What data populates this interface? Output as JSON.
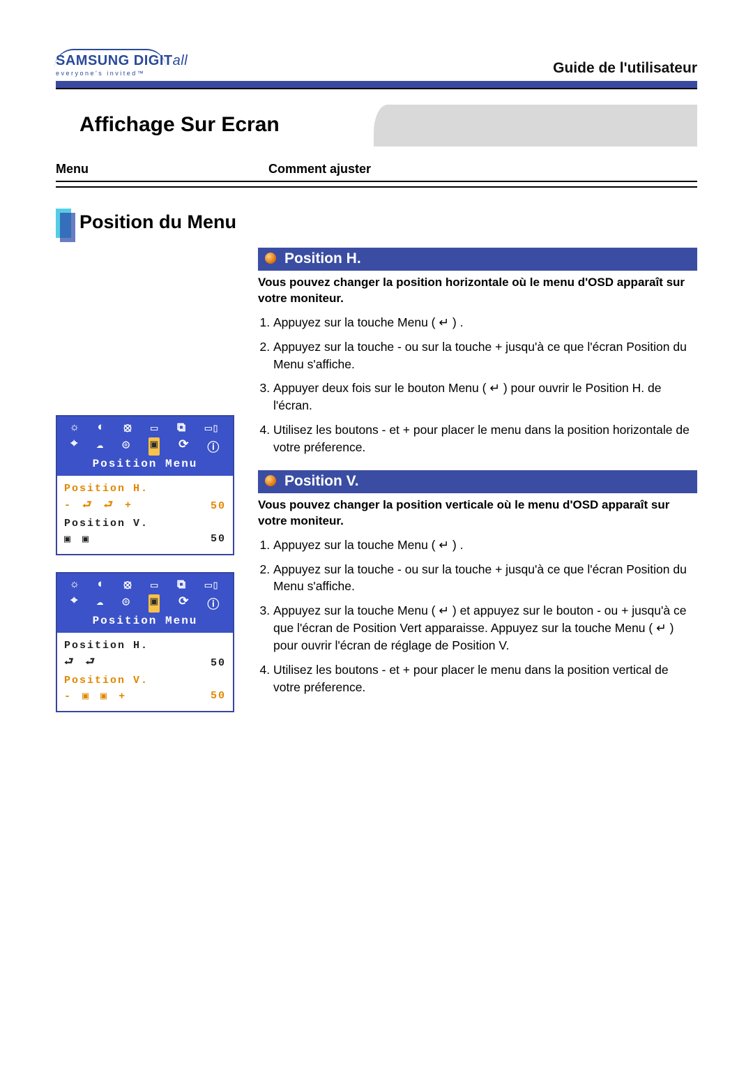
{
  "logo": {
    "brand": "SAMSUNG DIGIT",
    "brand_ital": "all",
    "tagline": "everyone's invited™"
  },
  "guide_title": "Guide de l'utilisateur",
  "page_title": "Affichage Sur Ecran",
  "columns": {
    "menu": "Menu",
    "adjust": "Comment ajuster"
  },
  "section_title": "Position du Menu",
  "position_h": {
    "heading": "Position H.",
    "desc": "Vous pouvez changer la position horizontale où le menu d'OSD apparaît sur votre moniteur.",
    "steps": [
      "Appuyez sur la touche Menu ( ↵ ) .",
      "Appuyez sur la touche - ou sur la touche + jusqu'à ce que l'écran Position du Menu s'affiche.",
      "Appuyer deux fois sur le bouton Menu ( ↵ ) pour ouvrir le Position H. de l'écran.",
      "Utilisez les boutons - et + pour placer le menu dans la position horizontale de votre préference."
    ]
  },
  "position_v": {
    "heading": "Position V.",
    "desc": "Vous pouvez changer la position verticale où le menu d'OSD apparaît sur votre moniteur.",
    "steps": [
      "Appuyez sur la touche Menu ( ↵ ) .",
      "Appuyez sur la touche - ou sur la touche + jusqu'à ce que l'écran Position du Menu s'affiche.",
      "Appuyez sur la touche Menu ( ↵ ) et appuyez sur le bouton - ou + jusqu'à ce que l'écran de Position Vert apparaisse. Appuyez sur la touche Menu ( ↵ ) pour ouvrir l'écran de réglage de Position V.",
      "Utilisez les boutons - et + pour placer le menu dans la position vertical de votre préference."
    ]
  },
  "osd": {
    "title": "Position Menu",
    "row_h_label": "Position H.",
    "row_v_label": "Position V.",
    "value_h": "50",
    "value_v": "50",
    "icons_row1": [
      "☼",
      "◐",
      "⦻",
      "▭",
      "⧉",
      "▭▯"
    ],
    "icons_row2": [
      "⌖",
      "☁",
      "◎",
      "▣",
      "⟳",
      "ⓘ"
    ],
    "adj_h": "- ⮐   ⮐ +",
    "adj_h_plain": "⮐   ⮐",
    "adj_v": "- ▣   ▣ +",
    "adj_v_plain": "▣   ▣"
  }
}
